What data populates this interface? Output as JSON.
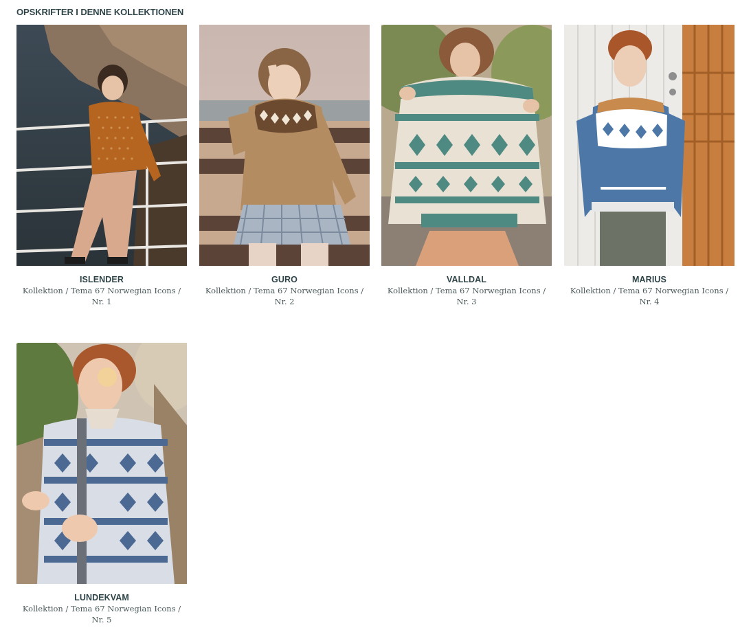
{
  "section": {
    "title": "OPSKRIFTER I DENNE KOLLEKTIONEN"
  },
  "patterns": [
    {
      "name": "ISLENDER",
      "meta": "Kollektion / Tema 67 Norwegian Icons / Nr. 1",
      "image_alt": "Boy in rust-orange patterned sweater standing by a railing at the sea"
    },
    {
      "name": "GURO",
      "meta": "Kollektion / Tema 67 Norwegian Icons / Nr. 2",
      "image_alt": "Girl in camel yoke sweater and gingham skirt sitting on a bench"
    },
    {
      "name": "VALLDAL",
      "meta": "Kollektion / Tema 67 Norwegian Icons / Nr. 3",
      "image_alt": "Girl holding up a teal and cream patterned sweater"
    },
    {
      "name": "MARIUS",
      "meta": "Kollektion / Tema 67 Norwegian Icons / Nr. 4",
      "image_alt": "Boy in blue Marius sweater standing by a wooden door"
    },
    {
      "name": "LUNDEKVAM",
      "meta": "Kollektion / Tema 67 Norwegian Icons / Nr. 5",
      "image_alt": "Boy in blue patterned cardigan leaning on a railing"
    }
  ],
  "colors": {
    "title_text": "#2e4448",
    "meta_text": "#4c5a5c",
    "background": "#ffffff"
  }
}
